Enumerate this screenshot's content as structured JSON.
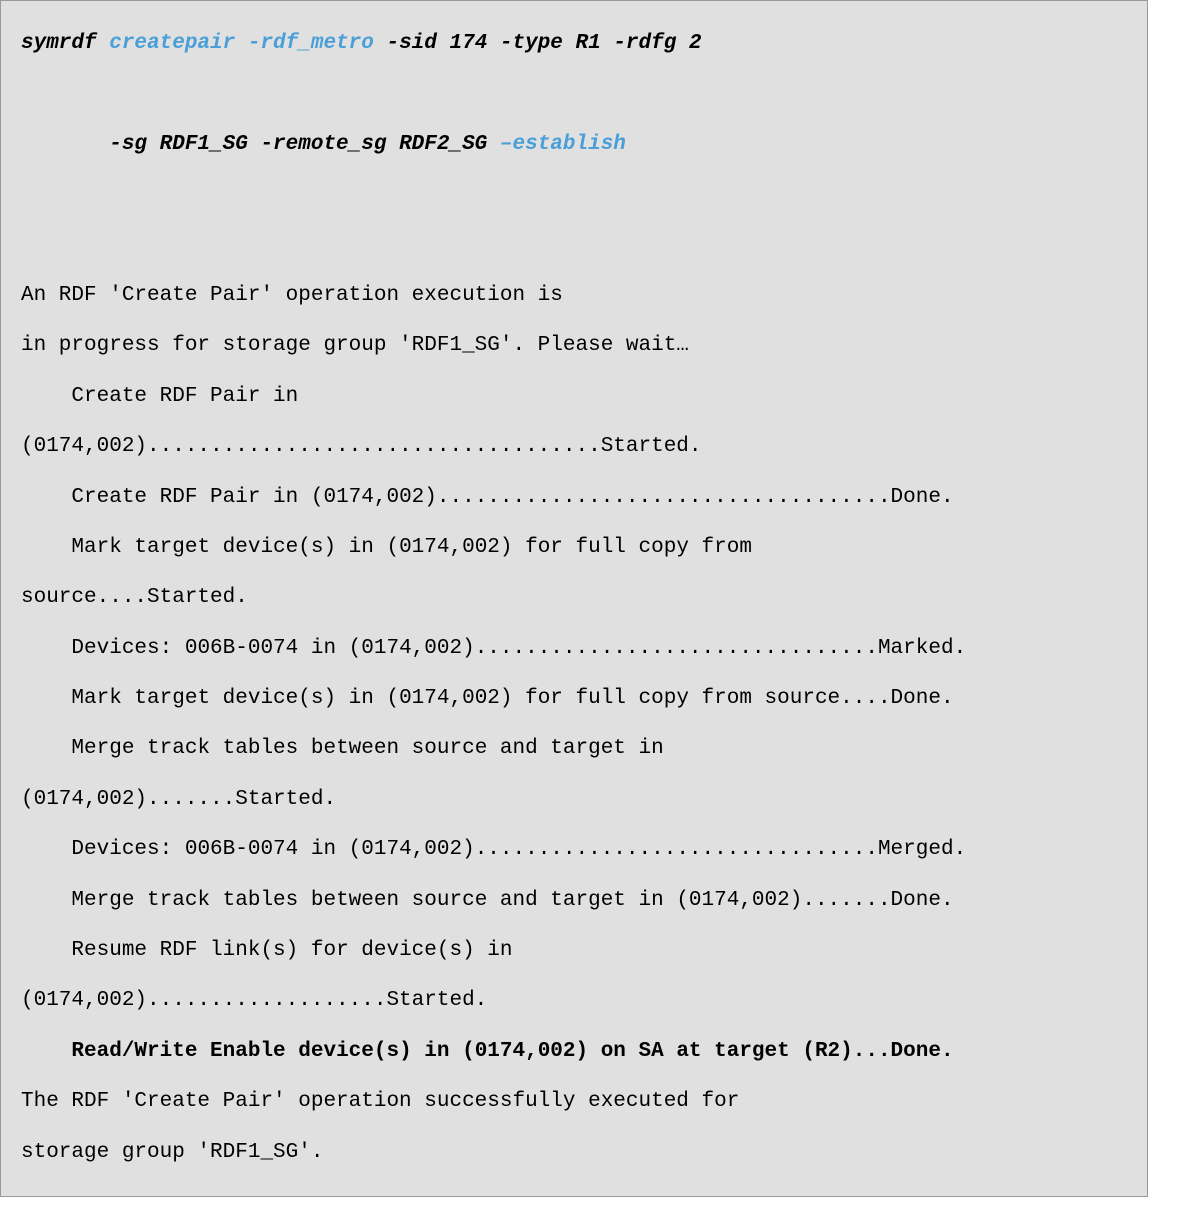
{
  "command": {
    "prefix": "symrdf ",
    "highlight1": "createpair -rdf_metro",
    "mid1": " -sid 174 -type R1 -rdfg 2",
    "line2_prefix": "       -sg RDF1_SG -remote_sg RDF2_SG ",
    "highlight2": "–establish"
  },
  "output": {
    "l1": "An RDF 'Create Pair' operation execution is",
    "l2": "in progress for storage group 'RDF1_SG'. Please wait…",
    "l3": "    Create RDF Pair in\n(0174,002)....................................Started.",
    "l4": "    Create RDF Pair in (0174,002)....................................Done.",
    "l5": "    Mark target device(s) in (0174,002) for full copy from\nsource....Started.",
    "l6": "    Devices: 006B-0074 in (0174,002)................................Marked.",
    "l7": "    Mark target device(s) in (0174,002) for full copy from source....Done.",
    "l8": "    Merge track tables between source and target in\n(0174,002).......Started.",
    "l9": "    Devices: 006B-0074 in (0174,002)................................Merged.",
    "l10": "    Merge track tables between source and target in (0174,002).......Done.",
    "l11": "    Resume RDF link(s) for device(s) in\n(0174,002)...................Started.",
    "l12": "    Read/Write Enable device(s) in (0174,002) on SA at target (R2)...Done.",
    "l13": "The RDF 'Create Pair' operation successfully executed for",
    "l14": "storage group 'RDF1_SG'."
  }
}
